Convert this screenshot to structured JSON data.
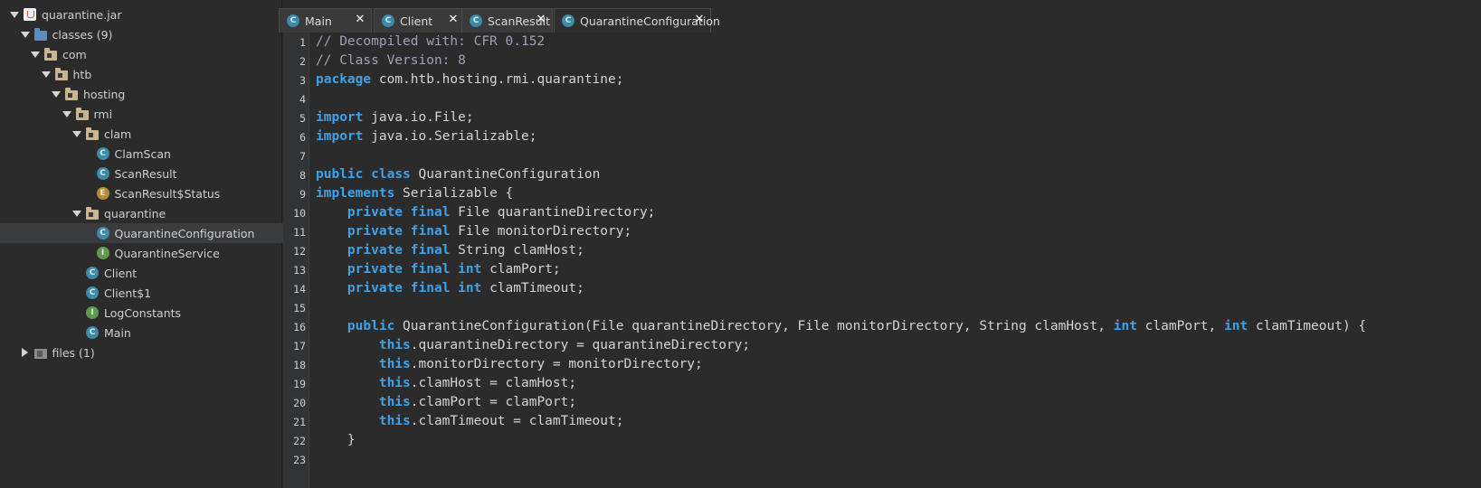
{
  "tree": [
    {
      "label": "quarantine.jar",
      "indent": 0,
      "arrow": "down",
      "icon": "jar",
      "icon_name": "jar-file-icon"
    },
    {
      "label": "classes (9)",
      "indent": 1,
      "arrow": "down",
      "icon": "folder",
      "icon_name": "folder-icon"
    },
    {
      "label": "com",
      "indent": 2,
      "arrow": "down",
      "icon": "pkg",
      "icon_name": "package-icon"
    },
    {
      "label": "htb",
      "indent": 3,
      "arrow": "down",
      "icon": "pkg",
      "icon_name": "package-icon"
    },
    {
      "label": "hosting",
      "indent": 4,
      "arrow": "down",
      "icon": "pkg",
      "icon_name": "package-icon"
    },
    {
      "label": "rmi",
      "indent": 5,
      "arrow": "down",
      "icon": "pkg",
      "icon_name": "package-icon"
    },
    {
      "label": "clam",
      "indent": 6,
      "arrow": "down",
      "icon": "pkg",
      "icon_name": "package-icon"
    },
    {
      "label": "ClamScan",
      "indent": 7,
      "arrow": "none",
      "icon": "cls",
      "glyph": "C",
      "icon_name": "class-icon"
    },
    {
      "label": "ScanResult",
      "indent": 7,
      "arrow": "none",
      "icon": "cls",
      "glyph": "C",
      "icon_name": "class-icon"
    },
    {
      "label": "ScanResult$Status",
      "indent": 7,
      "arrow": "none",
      "icon": "enm",
      "glyph": "E",
      "icon_name": "enum-icon"
    },
    {
      "label": "quarantine",
      "indent": 6,
      "arrow": "down",
      "icon": "pkg",
      "icon_name": "package-icon"
    },
    {
      "label": "QuarantineConfiguration",
      "indent": 7,
      "arrow": "none",
      "icon": "cls",
      "glyph": "C",
      "icon_name": "class-icon",
      "selected": true
    },
    {
      "label": "QuarantineService",
      "indent": 7,
      "arrow": "none",
      "icon": "ifc",
      "glyph": "I",
      "icon_name": "interface-icon"
    },
    {
      "label": "Client",
      "indent": 6,
      "arrow": "none",
      "icon": "cls",
      "glyph": "C",
      "icon_name": "class-icon"
    },
    {
      "label": "Client$1",
      "indent": 6,
      "arrow": "none",
      "icon": "cls",
      "glyph": "C",
      "icon_name": "class-icon"
    },
    {
      "label": "LogConstants",
      "indent": 6,
      "arrow": "none",
      "icon": "ifc",
      "glyph": "I",
      "icon_name": "interface-icon"
    },
    {
      "label": "Main",
      "indent": 6,
      "arrow": "none",
      "icon": "cls",
      "glyph": "C",
      "icon_name": "class-icon"
    },
    {
      "label": "files (1)",
      "indent": 1,
      "arrow": "right",
      "icon": "files",
      "icon_name": "files-folder-icon"
    }
  ],
  "tabs": [
    {
      "label": "Main",
      "glyph": "C",
      "close": "✕",
      "active": false
    },
    {
      "label": "Client",
      "glyph": "C",
      "close": "✕",
      "active": false
    },
    {
      "label": "ScanResult",
      "glyph": "C",
      "close": "✕",
      "active": false
    },
    {
      "label": "QuarantineConfiguration",
      "glyph": "C",
      "close": "✕",
      "active": true
    }
  ],
  "code_lines": [
    [
      [
        "cm",
        "// Decompiled with: CFR 0.152"
      ]
    ],
    [
      [
        "cm",
        "// Class Version: 8"
      ]
    ],
    [
      [
        "kw",
        "package"
      ],
      [
        "",
        "com.htb.hosting.rmi.quarantine;"
      ]
    ],
    [],
    [
      [
        "kw",
        "import"
      ],
      [
        "",
        "java.io.File;"
      ]
    ],
    [
      [
        "kw",
        "import"
      ],
      [
        "",
        "java.io.Serializable;"
      ]
    ],
    [],
    [
      [
        "kw",
        "public"
      ],
      [
        "kw",
        "class"
      ],
      [
        "",
        "QuarantineConfiguration"
      ]
    ],
    [
      [
        "kw",
        "implements"
      ],
      [
        "",
        "Serializable {"
      ]
    ],
    [
      [
        "",
        "    "
      ],
      [
        "kw",
        "private"
      ],
      [
        "kw",
        "final"
      ],
      [
        "",
        "File quarantineDirectory;"
      ]
    ],
    [
      [
        "",
        "    "
      ],
      [
        "kw",
        "private"
      ],
      [
        "kw",
        "final"
      ],
      [
        "",
        "File monitorDirectory;"
      ]
    ],
    [
      [
        "",
        "    "
      ],
      [
        "kw",
        "private"
      ],
      [
        "kw",
        "final"
      ],
      [
        "",
        "String clamHost;"
      ]
    ],
    [
      [
        "",
        "    "
      ],
      [
        "kw",
        "private"
      ],
      [
        "kw",
        "final"
      ],
      [
        "kw",
        "int"
      ],
      [
        "",
        "clamPort;"
      ]
    ],
    [
      [
        "",
        "    "
      ],
      [
        "kw",
        "private"
      ],
      [
        "kw",
        "final"
      ],
      [
        "kw",
        "int"
      ],
      [
        "",
        "clamTimeout;"
      ]
    ],
    [],
    [
      [
        "",
        "    "
      ],
      [
        "kw",
        "public"
      ],
      [
        "",
        "QuarantineConfiguration(File quarantineDirectory, File monitorDirectory, String clamHost,"
      ],
      [
        "kw",
        "int"
      ],
      [
        "",
        "clamPort,"
      ],
      [
        "kw",
        "int"
      ],
      [
        "",
        "clamTimeout) {"
      ]
    ],
    [
      [
        "",
        "        "
      ],
      [
        "kw",
        "this"
      ],
      [
        ".",
        ".quarantineDirectory = quarantineDirectory;"
      ]
    ],
    [
      [
        "",
        "        "
      ],
      [
        "kw",
        "this"
      ],
      [
        ".",
        ".monitorDirectory = monitorDirectory;"
      ]
    ],
    [
      [
        "",
        "        "
      ],
      [
        "kw",
        "this"
      ],
      [
        ".",
        ".clamHost = clamHost;"
      ]
    ],
    [
      [
        "",
        "        "
      ],
      [
        "kw",
        "this"
      ],
      [
        ".",
        ".clamPort = clamPort;"
      ]
    ],
    [
      [
        "",
        "        "
      ],
      [
        "kw",
        "this"
      ],
      [
        ".",
        ".clamTimeout = clamTimeout;"
      ]
    ],
    [
      [
        "",
        "    }"
      ]
    ],
    []
  ]
}
